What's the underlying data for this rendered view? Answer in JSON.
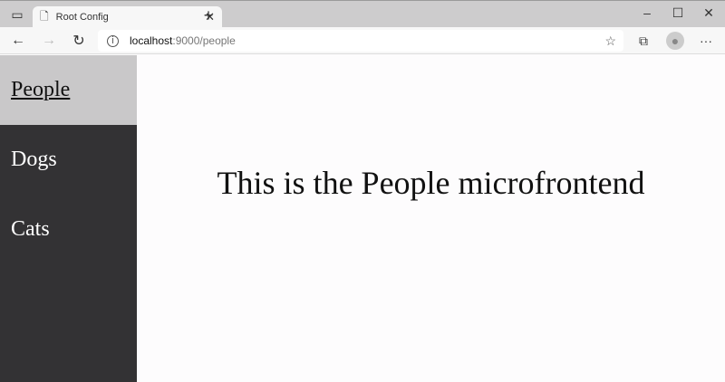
{
  "browser": {
    "tab_title": "Root Config",
    "url_host": "localhost",
    "url_rest": ":9000/people"
  },
  "sidebar": {
    "items": [
      {
        "label": "People",
        "active": true
      },
      {
        "label": "Dogs",
        "active": false
      },
      {
        "label": "Cats",
        "active": false
      }
    ]
  },
  "main": {
    "heading": "This is the People microfrontend"
  }
}
